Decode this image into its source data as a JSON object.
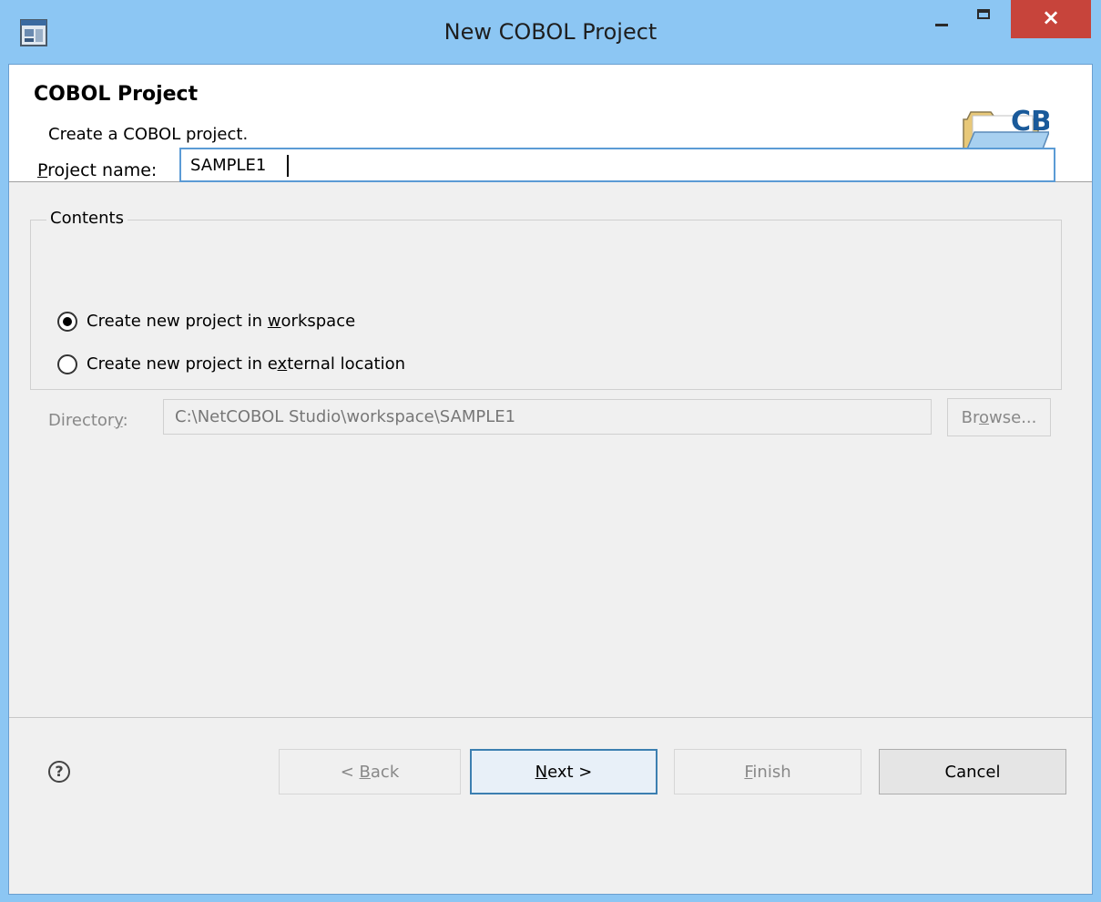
{
  "window": {
    "title": "New COBOL Project",
    "close_glyph": "×",
    "colors": {
      "titlebar": "#8cc6f3",
      "close": "#c7443b"
    }
  },
  "banner": {
    "title": "COBOL Project",
    "description": "Create a COBOL project.",
    "image_text": "CB",
    "image_icon": "folder-cb-icon"
  },
  "project": {
    "label_mnemonic": "P",
    "label_rest": "roject name:",
    "value": "SAMPLE1"
  },
  "contents": {
    "legend": "Contents",
    "options": [
      {
        "pre": "Create new project in ",
        "mnemonic": "w",
        "post": "orkspace",
        "selected": true
      },
      {
        "pre": "Create new project in e",
        "mnemonic": "x",
        "post": "ternal location",
        "selected": false
      }
    ],
    "directory_label_pre": "Director",
    "directory_label_mnemonic": "y",
    "directory_label_post": ":",
    "directory_value": "C:\\NetCOBOL Studio\\workspace\\SAMPLE1",
    "browse_pre": "Br",
    "browse_mnemonic": "o",
    "browse_post": "wse..."
  },
  "footer": {
    "help_glyph": "?",
    "back_pre": "< ",
    "back_mnemonic": "B",
    "back_post": "ack",
    "next_mnemonic": "N",
    "next_post": "ext >",
    "finish_mnemonic": "F",
    "finish_post": "inish",
    "cancel": "Cancel"
  }
}
